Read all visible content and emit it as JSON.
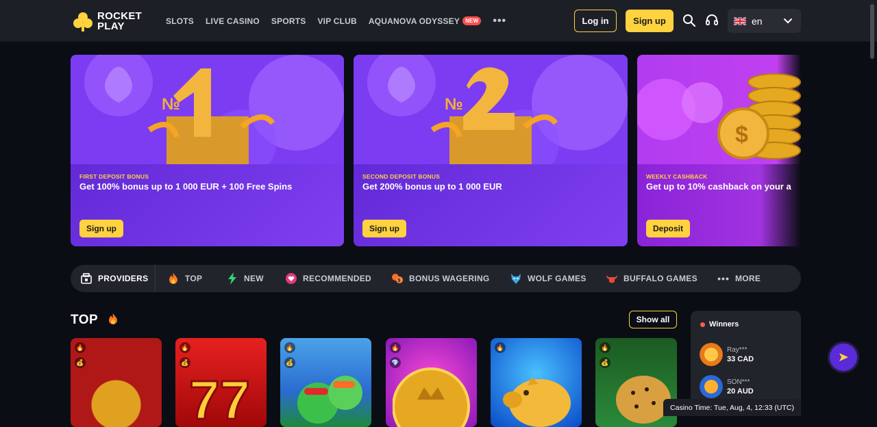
{
  "brand": {
    "line1": "ROCKET",
    "line2": "PLAY",
    "accent": "#ffd23f"
  },
  "nav": {
    "items": [
      "SLOTS",
      "LIVE CASINO",
      "SPORTS",
      "VIP CLUB",
      "AQUANOVA ODYSSEY"
    ],
    "new_badge": "NEW",
    "more": "•••"
  },
  "header": {
    "login_label": "Log in",
    "signup_label": "Sign up",
    "search_icon": "search-icon",
    "support_icon": "headset-icon",
    "language": "en",
    "language_flag": "uk-flag-icon"
  },
  "banners": [
    {
      "kicker": "FIRST DEPOSIT BONUS",
      "title": "Get 100% bonus up to 1 000 EUR + 100 Free Spins",
      "cta": "Sign up"
    },
    {
      "kicker": "SECOND DEPOSIT BONUS",
      "title": "Get 200% bonus up to 1 000 EUR",
      "cta": "Sign up"
    },
    {
      "kicker": "WEEKLY CASHBACK",
      "title": "Get up to 10% cashback on your a",
      "cta": "Deposit"
    }
  ],
  "filters": {
    "providers": "PROVIDERS",
    "items": [
      "TOP",
      "NEW",
      "RECOMMENDED",
      "BONUS WAGERING",
      "WOLF GAMES",
      "BUFFALO GAMES",
      "MORE"
    ]
  },
  "top_section": {
    "title": "TOP",
    "show_all": "Show all"
  },
  "winners": {
    "title": "Winners",
    "entries": [
      {
        "name": "Ray***",
        "amount": "33 CAD"
      },
      {
        "name": "SON***",
        "amount": "20 AUD"
      }
    ]
  },
  "casino_time": "Casino Time: Tue, Aug, 4, 12:33 (UTC)"
}
